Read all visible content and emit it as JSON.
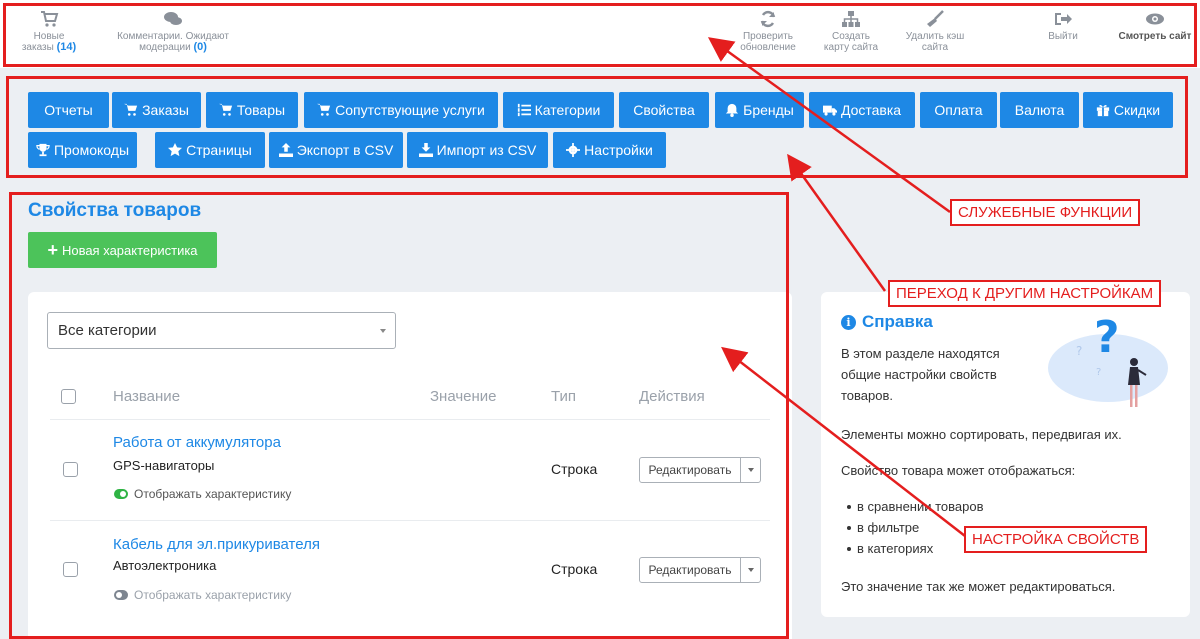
{
  "topbar": {
    "new_orders": {
      "label_line1": "Новые",
      "label_line2": "заказы",
      "count": "(14)"
    },
    "comments": {
      "label_line1": "Комментарии. Ожидают",
      "label_line2": "модерации",
      "count": "(0)"
    },
    "check_update": {
      "label_line1": "Проверить",
      "label_line2": "обновление"
    },
    "sitemap": {
      "label_line1": "Создать",
      "label_line2": "карту сайта"
    },
    "clear_cache": {
      "label_line1": "Удалить кэш",
      "label_line2": "сайта"
    },
    "logout": {
      "label": "Выйти"
    },
    "view_site": {
      "label": "Смотреть сайт"
    }
  },
  "nav": {
    "reports": "Отчеты",
    "orders": "Заказы",
    "products": "Товары",
    "services": "Сопутствующие услуги",
    "categories": "Категории",
    "properties": "Свойства",
    "brands": "Бренды",
    "delivery": "Доставка",
    "payment": "Оплата",
    "currency": "Валюта",
    "discounts": "Скидки",
    "promocodes": "Промокоды",
    "pages": "Страницы",
    "export_csv": "Экспорт в CSV",
    "import_csv": "Импорт из CSV",
    "settings": "Настройки"
  },
  "main": {
    "title": "Свойства товаров",
    "new_button": "Новая характеристика",
    "category_select": "Все категории",
    "columns": {
      "name": "Название",
      "value": "Значение",
      "type": "Тип",
      "actions": "Действия"
    },
    "rows": [
      {
        "name": "Работа от аккумулятора",
        "category": "GPS-навигаторы",
        "type": "Строка",
        "toggle": "Отображать характеристику",
        "enabled": true,
        "edit": "Редактировать"
      },
      {
        "name": "Кабель для эл.прикуривателя",
        "category": "Автоэлектроника",
        "type": "Строка",
        "toggle": "Отображать характеристику",
        "enabled": false,
        "edit": "Редактировать"
      }
    ]
  },
  "help": {
    "title": "Справка",
    "p1": "В этом разделе находятся общие настройки свойств товаров.",
    "p2": "Элементы можно сортировать, передвигая их.",
    "p3": "Свойство товара может отображаться:",
    "list": [
      "в сравнении товаров",
      "в фильтре",
      "в категориях"
    ],
    "p4": "Это значение так же может редактироваться."
  },
  "annotations": {
    "service": "СЛУЖЕБНЫЕ ФУНКЦИИ",
    "navigation": "ПЕРЕХОД К ДРУГИМ НАСТРОЙКАМ",
    "properties": "НАСТРОЙКА СВОЙСТВ"
  },
  "colors": {
    "accent": "#1e88e5",
    "success": "#4cc35a",
    "annotation": "#e41e1e"
  }
}
